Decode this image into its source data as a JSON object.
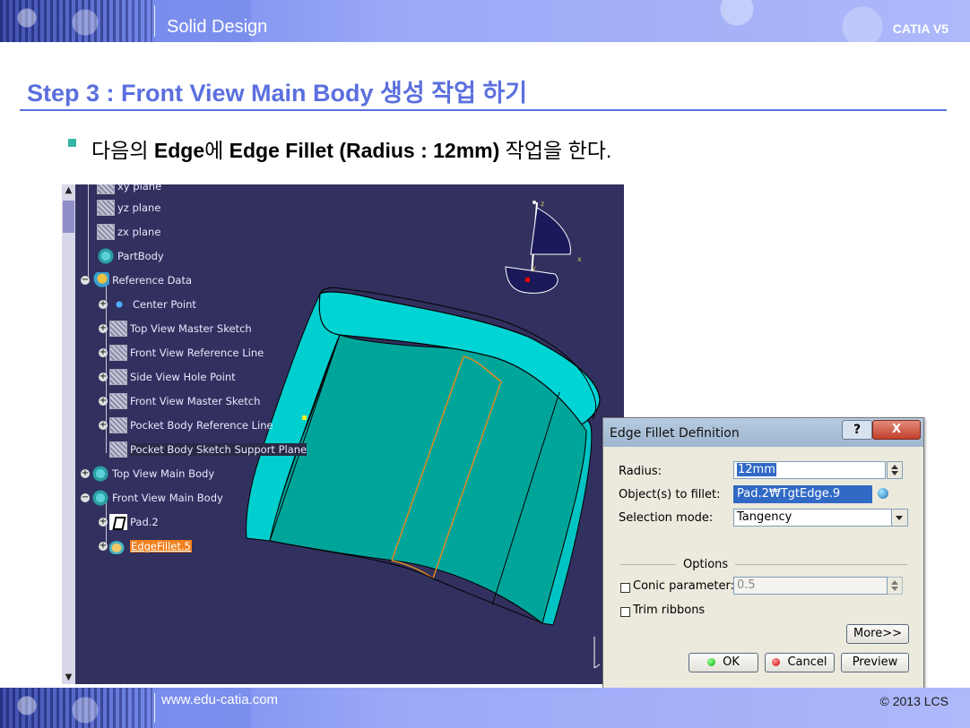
{
  "header": {
    "title": "Solid Design",
    "product": "CATIA V5"
  },
  "slide": {
    "step_title": "Step 3 : Front View Main Body 생성 작업 하기",
    "bullet_pre": "다음의 ",
    "bullet_b1": "Edge",
    "bullet_mid": "에 ",
    "bullet_b2": "Edge Fillet (Radius : 12mm)",
    "bullet_post": " 작업을 한다."
  },
  "tree": {
    "items": [
      {
        "label": "xy plane"
      },
      {
        "label": "yz plane"
      },
      {
        "label": "zx plane"
      },
      {
        "label": "PartBody"
      },
      {
        "label": "Reference Data"
      },
      {
        "label": "Center Point"
      },
      {
        "label": "Top View Master Sketch"
      },
      {
        "label": "Front View Reference Line"
      },
      {
        "label": "Side View Hole Point"
      },
      {
        "label": "Front View Master Sketch"
      },
      {
        "label": "Pocket Body Reference Line"
      },
      {
        "label": "Pocket Body Sketch Support Plane"
      },
      {
        "label": "Top View Main Body"
      },
      {
        "label": "Front View Main Body"
      },
      {
        "label": "Pad.2"
      },
      {
        "label": "EdgeFillet.5"
      }
    ]
  },
  "compass": {
    "z_label": "z",
    "x_label": "x",
    "y_label": "y"
  },
  "dialog": {
    "title": "Edge Fillet Definition",
    "help_label": "?",
    "close_label": "X",
    "radius_label": "Radius:",
    "radius_value": "12mm",
    "objects_label": "Object(s) to fillet:",
    "objects_value": "Pad.2₩TgtEdge.9",
    "selection_mode_label": "Selection mode:",
    "selection_mode_value": "Tangency",
    "options_label": "Options",
    "conic_label": "Conic parameter:",
    "conic_value": "0.5",
    "trim_label": "Trim ribbons",
    "more_label": "More>>",
    "ok_label": "OK",
    "cancel_label": "Cancel",
    "preview_label": "Preview"
  },
  "footer": {
    "url": "www.edu-catia.com",
    "copyright": "© 2013 LCS"
  },
  "colors": {
    "accent": "#5b6fde",
    "viewport_bg": "#31305e",
    "part_face": "#00a59a",
    "part_top": "#00cfcf",
    "edge_highlight": "#e08a1e"
  }
}
